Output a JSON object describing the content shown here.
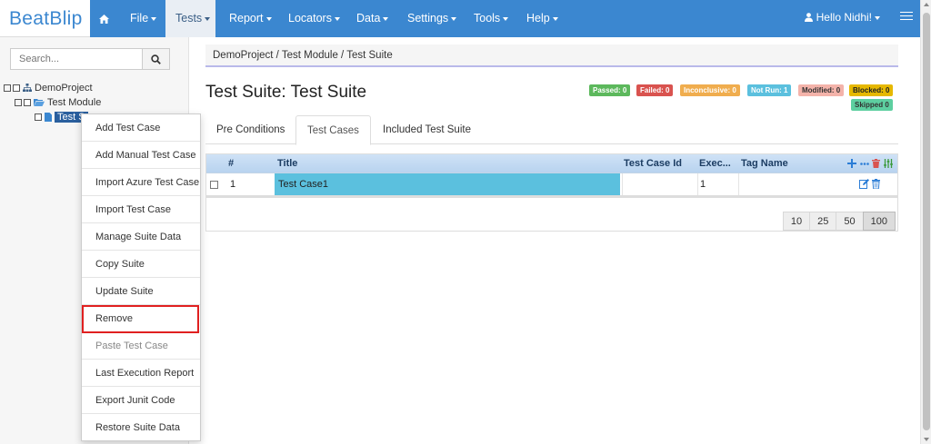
{
  "brand": "BeatBlip",
  "nav": {
    "items": [
      {
        "label": "File"
      },
      {
        "label": "Tests"
      },
      {
        "label": "Report"
      },
      {
        "label": "Locators"
      },
      {
        "label": "Data"
      },
      {
        "label": "Settings"
      },
      {
        "label": "Tools"
      },
      {
        "label": "Help"
      }
    ],
    "active": "Tests",
    "user": "Hello Nidhi!"
  },
  "sidebar": {
    "search_placeholder": "Search...",
    "tree": [
      {
        "label": "DemoProject",
        "level": 0
      },
      {
        "label": "Test Module",
        "level": 1
      },
      {
        "label": "Test S",
        "level": 2,
        "selected": true
      }
    ]
  },
  "context_menu": {
    "items": [
      "Add Test Case",
      "Add Manual Test Case",
      "Import Azure Test Case",
      "Import Test Case",
      "Manage Suite Data",
      "Copy Suite",
      "Update Suite",
      "Remove",
      "Paste Test Case",
      "Last Execution Report",
      "Export Junit Code",
      "Restore Suite Data"
    ],
    "highlighted": "Remove",
    "disabled": [
      "Paste Test Case"
    ]
  },
  "breadcrumb": "DemoProject / Test Module / Test Suite",
  "page_title": "Test Suite: Test Suite",
  "badges": [
    {
      "label": "Passed: 0",
      "bg": "#5cb85c",
      "color": "#ffffff"
    },
    {
      "label": "Failed: 0",
      "bg": "#d9534f",
      "color": "#ffffff"
    },
    {
      "label": "Inconclusive: 0",
      "bg": "#f0ad4e",
      "color": "#ffffff"
    },
    {
      "label": "Not Run: 1",
      "bg": "#5bc0de",
      "color": "#ffffff"
    },
    {
      "label": "Modified: 0",
      "bg": "#f4b3aa",
      "color": "#333333"
    },
    {
      "label": "Blocked: 0",
      "bg": "#e6b800",
      "color": "#222222"
    },
    {
      "label": "Skipped 0",
      "bg": "#5dcfa0",
      "color": "#333333"
    }
  ],
  "tabs": [
    "Pre Conditions",
    "Test Cases",
    "Included Test Suite"
  ],
  "active_tab": "Test Cases",
  "grid": {
    "headers": [
      "#",
      "Title",
      "Test Case Id",
      "Exec...",
      "Tag Name"
    ],
    "rows": [
      {
        "num": "1",
        "title": "Test Case1",
        "id": "",
        "exec": "1",
        "tag": ""
      }
    ],
    "page_sizes": [
      "10",
      "25",
      "50",
      "100"
    ],
    "active_page_size": "100"
  },
  "colors": {
    "navbar": "#3b87d0",
    "accent": "#5bc0de",
    "highlight_border": "#e02020"
  }
}
